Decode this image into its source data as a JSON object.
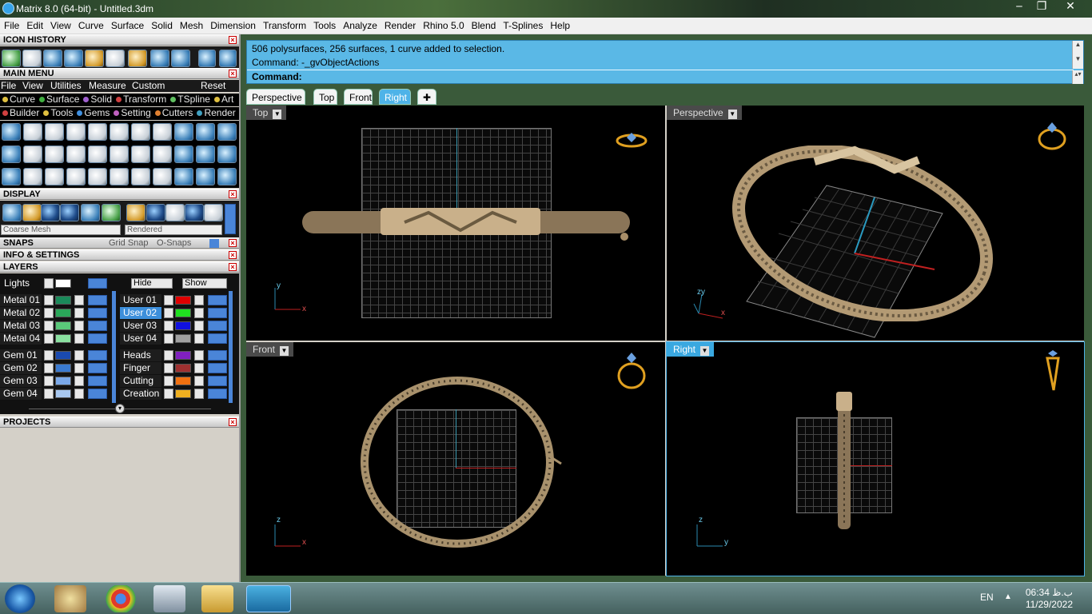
{
  "window": {
    "title": "Matrix 8.0 (64-bit) - Untitled.3dm",
    "min": "‒",
    "max": "❐",
    "close": "✕"
  },
  "menu": [
    "File",
    "Edit",
    "View",
    "Curve",
    "Surface",
    "Solid",
    "Mesh",
    "Dimension",
    "Transform",
    "Tools",
    "Analyze",
    "Render",
    "Rhino 5.0",
    "Blend",
    "T-Splines",
    "Help"
  ],
  "panels": {
    "icon_history": "ICON HISTORY",
    "main_menu": "MAIN MENU",
    "display": "DISPLAY",
    "snaps": "SNAPS",
    "info": "INFO & SETTINGS",
    "layers": "LAYERS",
    "projects": "PROJECTS"
  },
  "main_menu_items": [
    "File",
    "View",
    "Utilities",
    "Measure",
    "Custom"
  ],
  "main_menu_reset": "Reset",
  "categories_row1": [
    {
      "label": "Curve",
      "color": "#e0c040"
    },
    {
      "label": "Surface",
      "color": "#40b040"
    },
    {
      "label": "Solid",
      "color": "#a060d0"
    },
    {
      "label": "Transform",
      "color": "#d04040"
    },
    {
      "label": "TSpline",
      "color": "#60c060"
    },
    {
      "label": "Art",
      "color": "#e0c040"
    }
  ],
  "categories_row2": [
    {
      "label": "Builder",
      "color": "#d04040"
    },
    {
      "label": "Tools",
      "color": "#e0c040"
    },
    {
      "label": "Gems",
      "color": "#4090e0"
    },
    {
      "label": "Setting",
      "color": "#c060c0"
    },
    {
      "label": "Cutters",
      "color": "#e08030"
    },
    {
      "label": "Render",
      "color": "#40a0c0"
    }
  ],
  "display": {
    "mesh": "Coarse Mesh",
    "mode": "Rendered"
  },
  "snaps": {
    "grid": "Grid Snap",
    "osnap": "O-Snaps"
  },
  "layers": {
    "lights": "Lights",
    "hide": "Hide",
    "show": "Show",
    "left": [
      {
        "name": "Metal 01",
        "color": "#1a8a5a"
      },
      {
        "name": "Metal 02",
        "color": "#2aa85a"
      },
      {
        "name": "Metal 03",
        "color": "#5ac87a"
      },
      {
        "name": "Metal 04",
        "color": "#8ae0a0"
      },
      {
        "name": "Gem 01",
        "color": "#1a4ab0"
      },
      {
        "name": "Gem 02",
        "color": "#3a7ad0"
      },
      {
        "name": "Gem 03",
        "color": "#7aa8e8"
      },
      {
        "name": "Gem 04",
        "color": "#a8c8f0"
      }
    ],
    "right": [
      {
        "name": "User 01",
        "color": "#e00000",
        "selected": false
      },
      {
        "name": "User 02",
        "color": "#20e020",
        "selected": true
      },
      {
        "name": "User 03",
        "color": "#1010e0",
        "selected": false
      },
      {
        "name": "User 04",
        "color": "#a0a0a0",
        "selected": false
      },
      {
        "name": "Heads",
        "color": "#8020c0",
        "selected": false
      },
      {
        "name": "Finger",
        "color": "#a03030",
        "selected": false
      },
      {
        "name": "Cutting",
        "color": "#f07010",
        "selected": false
      },
      {
        "name": "Creation",
        "color": "#f0b020",
        "selected": false
      }
    ]
  },
  "command": {
    "line1": "506 polysurfaces, 256 surfaces, 1 curve added to selection.",
    "line2": "Command: -_gvObjectActions",
    "prompt": "Command:"
  },
  "view_tabs": [
    "Perspective",
    "Top",
    "Front",
    "Right"
  ],
  "active_tab": "Right",
  "viewports": {
    "top": "Top",
    "perspective": "Perspective",
    "front": "Front",
    "right": "Right"
  },
  "axes": {
    "x": "x",
    "y": "y",
    "z": "z",
    "zy": "zy"
  },
  "taskbar": {
    "lang": "EN",
    "time": "06:34 ب.ظ",
    "date": "11/29/2022"
  },
  "colors": {
    "accent": "#4eb3e8",
    "gold": "#c9a86a"
  }
}
